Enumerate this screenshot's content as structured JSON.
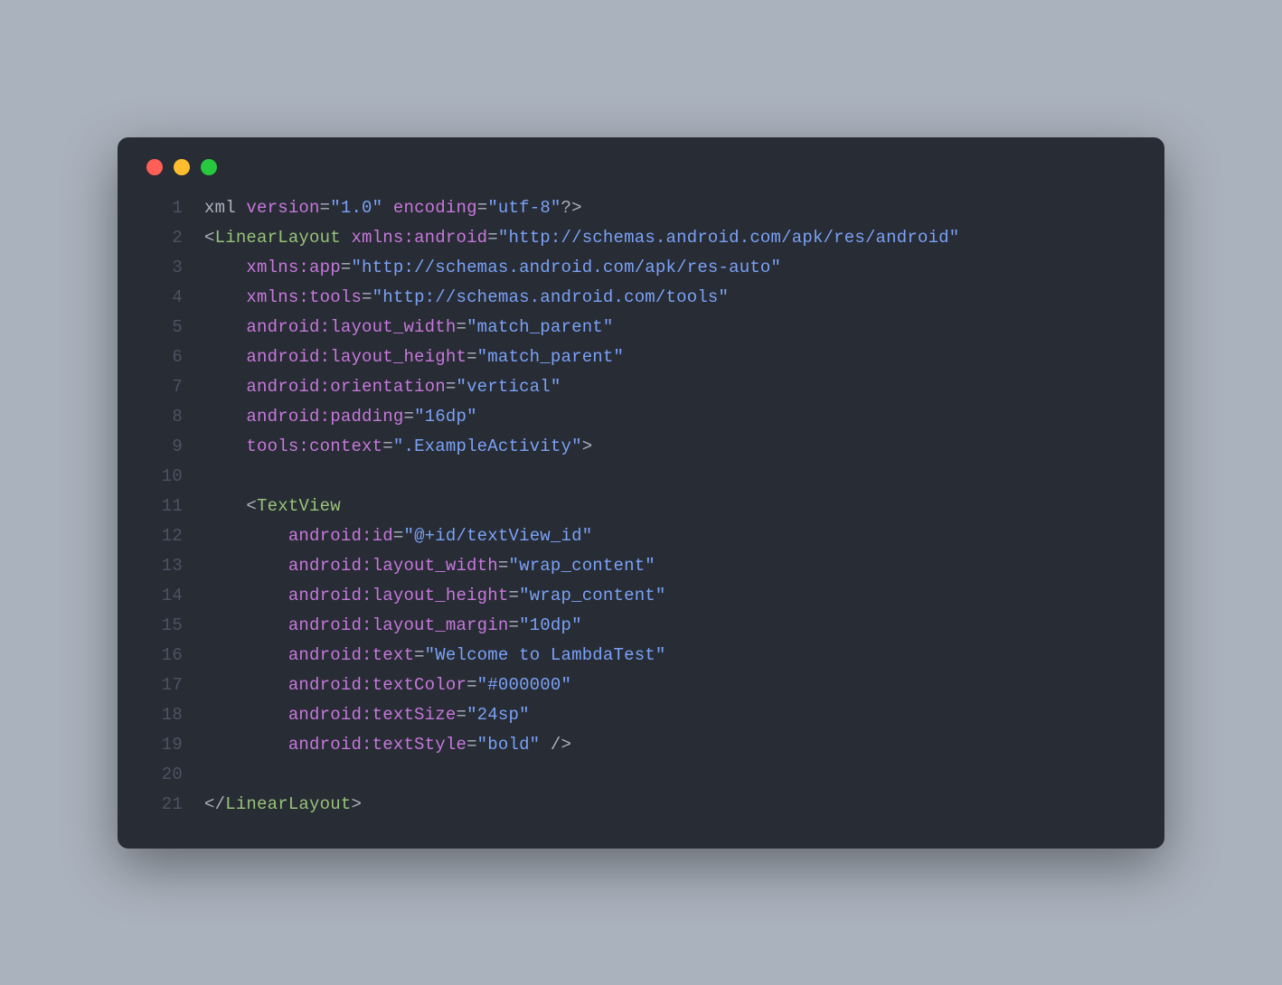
{
  "lines": [
    {
      "n": "1",
      "segs": [
        [
          "c-text",
          "xml "
        ],
        [
          "c-attr",
          "version"
        ],
        [
          "c-punct",
          "="
        ],
        [
          "c-string",
          "\"1.0\""
        ],
        [
          "c-text",
          " "
        ],
        [
          "c-attr",
          "encoding"
        ],
        [
          "c-punct",
          "="
        ],
        [
          "c-string",
          "\"utf-8\""
        ],
        [
          "c-punct",
          "?>"
        ]
      ]
    },
    {
      "n": "2",
      "segs": [
        [
          "c-punct",
          "<"
        ],
        [
          "c-tag",
          "LinearLayout"
        ],
        [
          "c-text",
          " "
        ],
        [
          "c-attr",
          "xmlns:android"
        ],
        [
          "c-punct",
          "="
        ],
        [
          "c-string",
          "\"http://schemas.android.com/apk/res/android\""
        ]
      ]
    },
    {
      "n": "3",
      "segs": [
        [
          "c-text",
          "    "
        ],
        [
          "c-attr",
          "xmlns:app"
        ],
        [
          "c-punct",
          "="
        ],
        [
          "c-string",
          "\"http://schemas.android.com/apk/res-auto\""
        ]
      ]
    },
    {
      "n": "4",
      "segs": [
        [
          "c-text",
          "    "
        ],
        [
          "c-attr",
          "xmlns:tools"
        ],
        [
          "c-punct",
          "="
        ],
        [
          "c-string",
          "\"http://schemas.android.com/tools\""
        ]
      ]
    },
    {
      "n": "5",
      "segs": [
        [
          "c-text",
          "    "
        ],
        [
          "c-attr",
          "android:layout_width"
        ],
        [
          "c-punct",
          "="
        ],
        [
          "c-string",
          "\"match_parent\""
        ]
      ]
    },
    {
      "n": "6",
      "segs": [
        [
          "c-text",
          "    "
        ],
        [
          "c-attr",
          "android:layout_height"
        ],
        [
          "c-punct",
          "="
        ],
        [
          "c-string",
          "\"match_parent\""
        ]
      ]
    },
    {
      "n": "7",
      "segs": [
        [
          "c-text",
          "    "
        ],
        [
          "c-attr",
          "android:orientation"
        ],
        [
          "c-punct",
          "="
        ],
        [
          "c-string",
          "\"vertical\""
        ]
      ]
    },
    {
      "n": "8",
      "segs": [
        [
          "c-text",
          "    "
        ],
        [
          "c-attr",
          "android:padding"
        ],
        [
          "c-punct",
          "="
        ],
        [
          "c-string",
          "\"16dp\""
        ]
      ]
    },
    {
      "n": "9",
      "segs": [
        [
          "c-text",
          "    "
        ],
        [
          "c-attr",
          "tools:context"
        ],
        [
          "c-punct",
          "="
        ],
        [
          "c-string",
          "\".ExampleActivity\""
        ],
        [
          "c-punct",
          ">"
        ]
      ]
    },
    {
      "n": "10",
      "segs": [
        [
          "c-text",
          ""
        ]
      ]
    },
    {
      "n": "11",
      "segs": [
        [
          "c-text",
          "    "
        ],
        [
          "c-punct",
          "<"
        ],
        [
          "c-tag",
          "TextView"
        ]
      ]
    },
    {
      "n": "12",
      "segs": [
        [
          "c-text",
          "        "
        ],
        [
          "c-attr",
          "android:id"
        ],
        [
          "c-punct",
          "="
        ],
        [
          "c-string",
          "\"@+id/textView_id\""
        ]
      ]
    },
    {
      "n": "13",
      "segs": [
        [
          "c-text",
          "        "
        ],
        [
          "c-attr",
          "android:layout_width"
        ],
        [
          "c-punct",
          "="
        ],
        [
          "c-string",
          "\"wrap_content\""
        ]
      ]
    },
    {
      "n": "14",
      "segs": [
        [
          "c-text",
          "        "
        ],
        [
          "c-attr",
          "android:layout_height"
        ],
        [
          "c-punct",
          "="
        ],
        [
          "c-string",
          "\"wrap_content\""
        ]
      ]
    },
    {
      "n": "15",
      "segs": [
        [
          "c-text",
          "        "
        ],
        [
          "c-attr",
          "android:layout_margin"
        ],
        [
          "c-punct",
          "="
        ],
        [
          "c-string",
          "\"10dp\""
        ]
      ]
    },
    {
      "n": "16",
      "segs": [
        [
          "c-text",
          "        "
        ],
        [
          "c-attr",
          "android:text"
        ],
        [
          "c-punct",
          "="
        ],
        [
          "c-string",
          "\"Welcome to LambdaTest\""
        ]
      ]
    },
    {
      "n": "17",
      "segs": [
        [
          "c-text",
          "        "
        ],
        [
          "c-attr",
          "android:textColor"
        ],
        [
          "c-punct",
          "="
        ],
        [
          "c-string",
          "\"#000000\""
        ]
      ]
    },
    {
      "n": "18",
      "segs": [
        [
          "c-text",
          "        "
        ],
        [
          "c-attr",
          "android:textSize"
        ],
        [
          "c-punct",
          "="
        ],
        [
          "c-string",
          "\"24sp\""
        ]
      ]
    },
    {
      "n": "19",
      "segs": [
        [
          "c-text",
          "        "
        ],
        [
          "c-attr",
          "android:textStyle"
        ],
        [
          "c-punct",
          "="
        ],
        [
          "c-string",
          "\"bold\""
        ],
        [
          "c-text",
          " "
        ],
        [
          "c-punct",
          "/>"
        ]
      ]
    },
    {
      "n": "20",
      "segs": [
        [
          "c-text",
          ""
        ]
      ]
    },
    {
      "n": "21",
      "segs": [
        [
          "c-punct",
          "</"
        ],
        [
          "c-tag",
          "LinearLayout"
        ],
        [
          "c-punct",
          ">"
        ]
      ]
    }
  ]
}
